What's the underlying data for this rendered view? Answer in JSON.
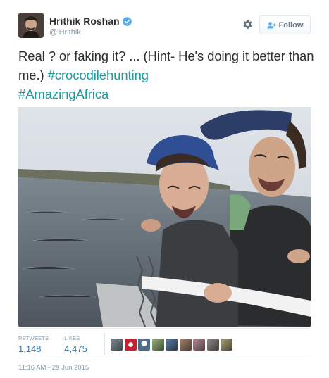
{
  "user": {
    "display_name": "Hrithik Roshan",
    "handle": "@iHrithik",
    "avatar_icon": "profile-photo",
    "verified_icon": "verified-badge-icon"
  },
  "actions": {
    "follow_label": "Follow",
    "follow_icon": "add-person-icon",
    "settings_icon": "gear-icon"
  },
  "tweet": {
    "text_part1": "Real ? or faking it? ... (Hint- He's doing it better than me.) ",
    "hashtag1": "#crocodilehunting",
    "hashtag2": "#AmazingAfrica"
  },
  "stats": {
    "retweets_label": "RETWEETS",
    "retweets_value": "1,148",
    "likes_label": "LIKES",
    "likes_value": "4,475"
  },
  "favoriters_count_shown": 9,
  "timestamp": "11:16 AM - 29 Jun 2015",
  "colors": {
    "link": "#2b7bb9",
    "hashtag": "#1a9ba0",
    "muted": "#8899a6",
    "text": "#292f33"
  }
}
